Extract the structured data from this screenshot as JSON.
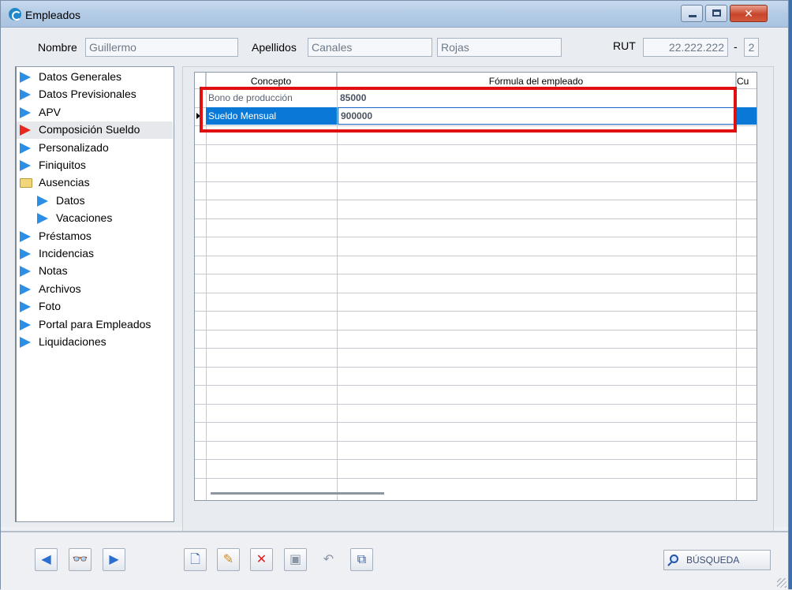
{
  "window": {
    "title": "Empleados"
  },
  "header": {
    "nombre_label": "Nombre",
    "nombre_value": "Guillermo",
    "apellidos_label": "Apellidos",
    "apellido1_value": "Canales",
    "apellido2_value": "Rojas",
    "rut_label": "RUT",
    "rut_value": "22.222.222",
    "rut_sep": "-",
    "rut_dv": "2"
  },
  "sidebar": {
    "items": [
      {
        "label": "Datos Generales",
        "icon": "blue-triangle"
      },
      {
        "label": "Datos Previsionales",
        "icon": "blue-triangle"
      },
      {
        "label": "APV",
        "icon": "blue-triangle"
      },
      {
        "label": "Composición Sueldo",
        "icon": "red-triangle",
        "selected": true
      },
      {
        "label": "Personalizado",
        "icon": "blue-triangle"
      },
      {
        "label": "Finiquitos",
        "icon": "blue-triangle"
      },
      {
        "label": "Ausencias",
        "icon": "folder"
      },
      {
        "label": "Datos",
        "icon": "blue-triangle",
        "sub": true
      },
      {
        "label": "Vacaciones",
        "icon": "blue-triangle",
        "sub": true
      },
      {
        "label": "Préstamos",
        "icon": "blue-triangle"
      },
      {
        "label": "Incidencias",
        "icon": "blue-triangle"
      },
      {
        "label": "Notas",
        "icon": "blue-triangle"
      },
      {
        "label": "Archivos",
        "icon": "blue-triangle"
      },
      {
        "label": "Foto",
        "icon": "blue-triangle"
      },
      {
        "label": "Portal para Empleados",
        "icon": "blue-triangle"
      },
      {
        "label": "Liquidaciones",
        "icon": "blue-triangle"
      }
    ]
  },
  "grid": {
    "columns": [
      "Concepto",
      "Fórmula del empleado",
      "Cu"
    ],
    "rows": [
      {
        "concepto": "Bono de producción",
        "formula": "85000"
      },
      {
        "concepto": "Sueldo Mensual",
        "formula": "900000"
      }
    ]
  },
  "toolbar": {
    "search_label": "BÚSQUEDA"
  },
  "colors": {
    "selection": "#0a78d7",
    "highlight": "#e01010",
    "nav_arrow": "#2d8ee6",
    "nav_arrow_active": "#e8281e"
  }
}
